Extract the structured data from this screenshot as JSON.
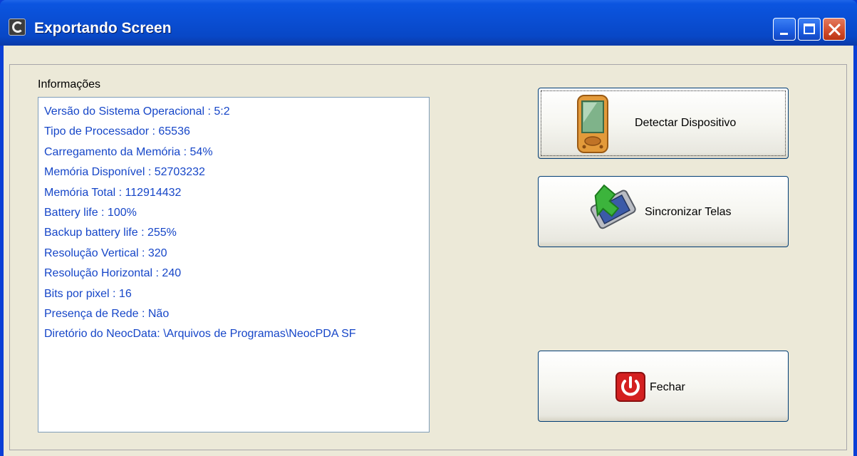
{
  "window": {
    "title": "Exportando Screen"
  },
  "info": {
    "label": "Informações",
    "lines": [
      "Versão do Sistema Operacional : 5:2",
      "Tipo de Processador : 65536",
      "Carregamento da Memória : 54%",
      "Memória Disponível : 52703232",
      "Memória Total : 112914432",
      "Battery life : 100%",
      "Backup battery life : 255%",
      "Resolução Vertical : 320",
      "Resolução Horizontal : 240",
      "Bits por pixel : 16",
      "Presença de Rede : Não",
      "Diretório do NeocData: \\Arquivos de Programas\\NeocPDA SF"
    ]
  },
  "buttons": {
    "detect": "Detectar Dispositivo",
    "sync": "Sincronizar Telas",
    "close": "Fechar"
  },
  "colors": {
    "titlebar": "#0a4fd5",
    "info_text": "#1646c8",
    "face": "#ece9d8"
  }
}
